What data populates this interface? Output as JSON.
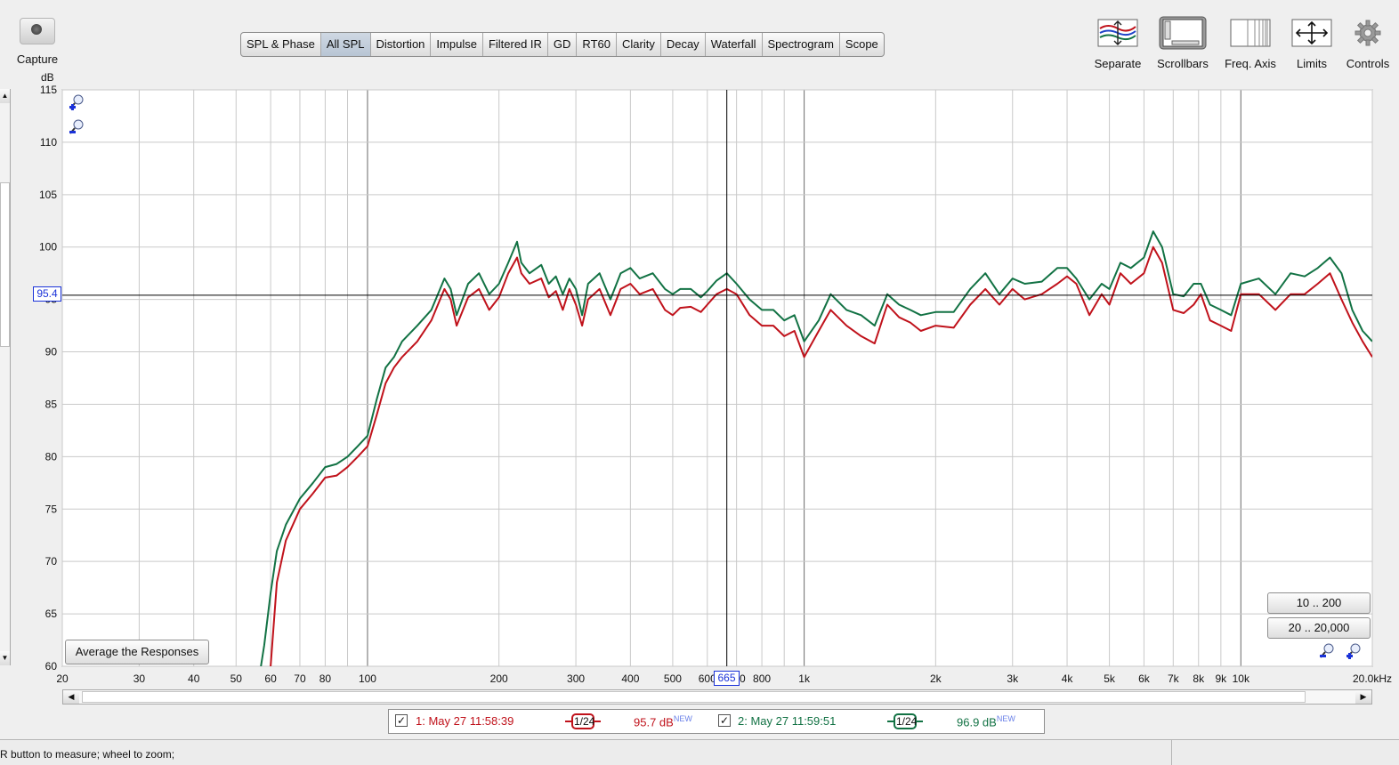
{
  "toolbar": {
    "capture_label": "Capture",
    "tabs": [
      "SPL & Phase",
      "All SPL",
      "Distortion",
      "Impulse",
      "Filtered IR",
      "GD",
      "RT60",
      "Clarity",
      "Decay",
      "Waterfall",
      "Spectrogram",
      "Scope"
    ],
    "active_tab": "All SPL",
    "tools": [
      {
        "label": "Separate",
        "icon": "separate-icon"
      },
      {
        "label": "Scrollbars",
        "icon": "scrollbars-icon"
      },
      {
        "label": "Freq. Axis",
        "icon": "freq-axis-icon"
      },
      {
        "label": "Limits",
        "icon": "limits-icon"
      },
      {
        "label": "Controls",
        "icon": "gear-icon"
      }
    ]
  },
  "buttons": {
    "average": "Average the Responses",
    "range_10_200": "10 .. 200",
    "range_20_20000": "20 .. 20,000"
  },
  "cursor": {
    "y_value": "95.4",
    "x_value": "665"
  },
  "legend": [
    {
      "checked": true,
      "name": "1: May 27 11:58:39",
      "smoothing": "1/24",
      "level": "95.7 dB",
      "badge": "NEW",
      "color": "#c0121b"
    },
    {
      "checked": true,
      "name": "2: May 27 11:59:51",
      "smoothing": "1/24",
      "level": "96.9 dB",
      "badge": "NEW",
      "color": "#127244"
    }
  ],
  "status": {
    "text": "R button to measure; wheel to zoom;"
  },
  "chart_data": {
    "type": "line",
    "x_scale": "log",
    "xlim": [
      20,
      20000
    ],
    "ylim": [
      60,
      115
    ],
    "ylabel": "dB",
    "y_ticks": [
      60,
      65,
      70,
      75,
      80,
      85,
      90,
      95,
      100,
      105,
      110,
      115
    ],
    "x_tick_labels": [
      {
        "v": 20,
        "t": "20"
      },
      {
        "v": 30,
        "t": "30"
      },
      {
        "v": 40,
        "t": "40"
      },
      {
        "v": 50,
        "t": "50"
      },
      {
        "v": 60,
        "t": "60"
      },
      {
        "v": 70,
        "t": "70"
      },
      {
        "v": 80,
        "t": "80"
      },
      {
        "v": 100,
        "t": "100"
      },
      {
        "v": 200,
        "t": "200"
      },
      {
        "v": 300,
        "t": "300"
      },
      {
        "v": 400,
        "t": "400"
      },
      {
        "v": 500,
        "t": "500"
      },
      {
        "v": 600,
        "t": "600"
      },
      {
        "v": 700,
        "t": "700"
      },
      {
        "v": 800,
        "t": "800"
      },
      {
        "v": 1000,
        "t": "1k"
      },
      {
        "v": 2000,
        "t": "2k"
      },
      {
        "v": 3000,
        "t": "3k"
      },
      {
        "v": 4000,
        "t": "4k"
      },
      {
        "v": 5000,
        "t": "5k"
      },
      {
        "v": 6000,
        "t": "6k"
      },
      {
        "v": 7000,
        "t": "7k"
      },
      {
        "v": 8000,
        "t": "8k"
      },
      {
        "v": 9000,
        "t": "9k"
      },
      {
        "v": 10000,
        "t": "10k"
      },
      {
        "v": 20000,
        "t": "20.0kHz"
      }
    ],
    "grid": true,
    "cursor": {
      "x": 665,
      "y": 95.4
    },
    "series": [
      {
        "name": "1: May 27 11:58:39",
        "color": "#c0121b",
        "x": [
          58,
          60,
          62,
          65,
          70,
          75,
          80,
          85,
          90,
          95,
          100,
          105,
          110,
          115,
          120,
          130,
          140,
          150,
          155,
          160,
          170,
          180,
          190,
          200,
          210,
          220,
          225,
          235,
          250,
          260,
          270,
          280,
          290,
          300,
          310,
          320,
          340,
          360,
          380,
          400,
          420,
          450,
          480,
          500,
          520,
          550,
          580,
          600,
          630,
          665,
          700,
          750,
          800,
          850,
          900,
          950,
          1000,
          1080,
          1150,
          1250,
          1350,
          1450,
          1550,
          1650,
          1750,
          1850,
          2000,
          2200,
          2400,
          2600,
          2800,
          3000,
          3200,
          3500,
          3800,
          4000,
          4200,
          4500,
          4800,
          5000,
          5300,
          5600,
          6000,
          6300,
          6600,
          7000,
          7400,
          7800,
          8100,
          8500,
          9000,
          9500,
          10000,
          11000,
          12000,
          13000,
          14000,
          15000,
          16000,
          17000,
          18000,
          19000,
          20000
        ],
        "y": [
          57,
          60,
          68,
          72,
          75,
          76.5,
          78,
          78.2,
          79,
          80,
          81,
          84,
          87,
          88.5,
          89.5,
          91,
          93,
          96,
          95,
          92.5,
          95.2,
          96,
          94,
          95.2,
          97.5,
          99,
          97.5,
          96.5,
          97,
          95.2,
          95.8,
          94,
          96,
          94.5,
          92.5,
          95,
          96,
          93.5,
          96,
          96.5,
          95.5,
          96,
          94,
          93.5,
          94.2,
          94.3,
          93.8,
          94.5,
          95.5,
          96,
          95.5,
          93.5,
          92.5,
          92.5,
          91.5,
          92,
          89.5,
          92,
          94,
          92.5,
          91.5,
          90.8,
          94.5,
          93.3,
          92.8,
          92,
          92.5,
          92.3,
          94.5,
          96,
          94.5,
          96,
          95,
          95.5,
          96.5,
          97.2,
          96.5,
          93.5,
          95.5,
          94.5,
          97.5,
          96.5,
          97.5,
          100,
          98.5,
          94,
          93.7,
          94.5,
          95.5,
          93,
          92.5,
          92,
          95.5,
          95.5,
          94,
          95.5,
          95.5,
          96.5,
          97.5,
          95,
          92.8,
          91,
          89.5
        ]
      },
      {
        "name": "2: May 27 11:59:51",
        "color": "#127244",
        "x": [
          57,
          58,
          60,
          62,
          65,
          70,
          75,
          80,
          85,
          90,
          95,
          100,
          105,
          110,
          115,
          120,
          130,
          140,
          150,
          155,
          160,
          170,
          180,
          190,
          200,
          210,
          220,
          225,
          235,
          250,
          260,
          270,
          280,
          290,
          300,
          310,
          320,
          340,
          360,
          380,
          400,
          420,
          450,
          480,
          500,
          520,
          550,
          580,
          600,
          630,
          665,
          700,
          750,
          800,
          850,
          900,
          950,
          1000,
          1080,
          1150,
          1250,
          1350,
          1450,
          1550,
          1650,
          1750,
          1850,
          2000,
          2200,
          2400,
          2600,
          2800,
          3000,
          3200,
          3500,
          3800,
          4000,
          4200,
          4500,
          4800,
          5000,
          5300,
          5600,
          6000,
          6300,
          6600,
          7000,
          7400,
          7800,
          8100,
          8500,
          9000,
          9500,
          10000,
          11000,
          12000,
          13000,
          14000,
          15000,
          16000,
          17000,
          18000,
          19000,
          20000
        ],
        "y": [
          60,
          62,
          67,
          71,
          73.5,
          76,
          77.5,
          79,
          79.3,
          80,
          81,
          82,
          85.5,
          88.5,
          89.5,
          91,
          92.5,
          94,
          97,
          96,
          93.5,
          96.5,
          97.5,
          95.5,
          96.5,
          98.5,
          100.5,
          98.5,
          97.5,
          98.3,
          96.5,
          97.2,
          95.5,
          97,
          96,
          93.5,
          96.5,
          97.5,
          95,
          97.5,
          98,
          97,
          97.5,
          96,
          95.5,
          96,
          96,
          95.2,
          95.8,
          96.8,
          97.5,
          96.5,
          95,
          94,
          94,
          93,
          93.5,
          91,
          93,
          95.5,
          94,
          93.5,
          92.5,
          95.5,
          94.5,
          94,
          93.5,
          93.8,
          93.8,
          96,
          97.5,
          95.5,
          97,
          96.5,
          96.7,
          98,
          98,
          97,
          95,
          96.5,
          96,
          98.5,
          98,
          99,
          101.5,
          100,
          95.5,
          95.3,
          96.5,
          96.5,
          94.5,
          94,
          93.5,
          96.5,
          97,
          95.5,
          97.5,
          97.2,
          98,
          99,
          97.5,
          94,
          92,
          91
        ]
      }
    ]
  }
}
